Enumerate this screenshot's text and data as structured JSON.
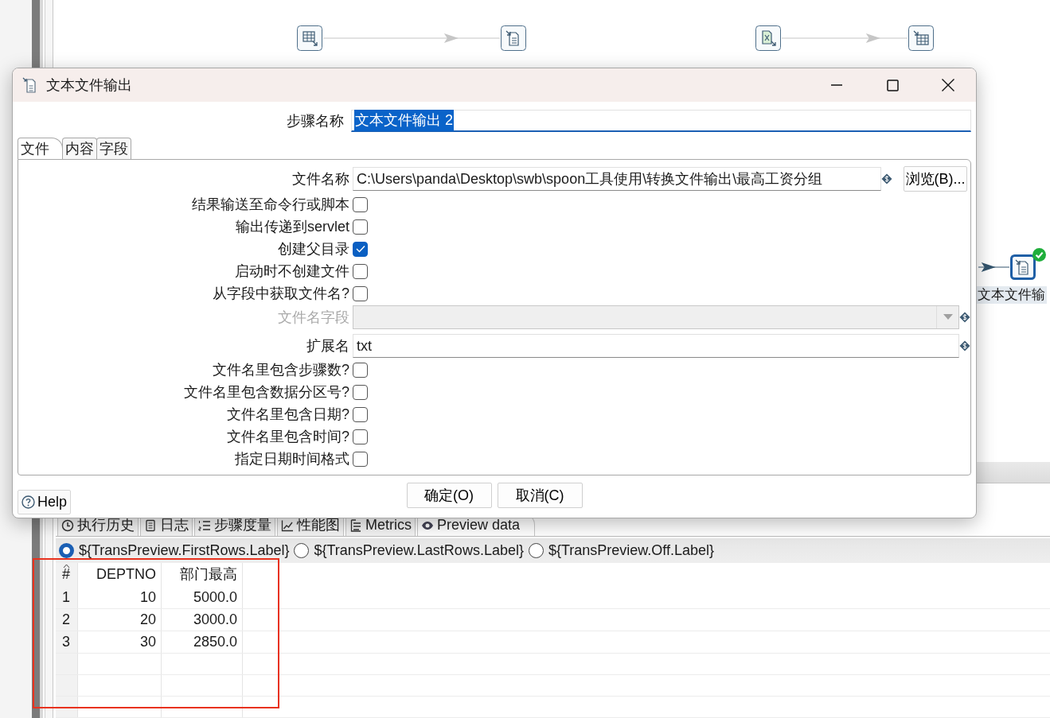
{
  "canvas": {
    "nodes": [
      {
        "kind": "table_input",
        "selected": false,
        "outgoing_hop": true
      },
      {
        "kind": "text_output",
        "selected": false
      },
      {
        "kind": "excel_input",
        "selected": false,
        "outgoing_hop": true
      },
      {
        "kind": "table_output",
        "selected": false
      },
      {
        "kind": "text_output",
        "label": "文本文件输",
        "selected": true,
        "finished": true,
        "incoming_hop": true
      }
    ]
  },
  "results": {
    "tabs": [
      {
        "kind": "history",
        "label": "执行历史",
        "selected": false
      },
      {
        "kind": "log",
        "label": "日志",
        "selected": false
      },
      {
        "kind": "step_metrics",
        "label": "步骤度量",
        "selected": false
      },
      {
        "kind": "performance",
        "label": "性能图",
        "selected": false
      },
      {
        "kind": "metrics",
        "label": "Metrics",
        "selected": false
      },
      {
        "kind": "preview",
        "label": "Preview data",
        "selected": true
      }
    ],
    "preview_modes": [
      {
        "label": "${TransPreview.FirstRows.Label}",
        "selected": true
      },
      {
        "label": "${TransPreview.LastRows.Label}",
        "selected": false
      },
      {
        "label": "${TransPreview.Off.Label}",
        "selected": false
      }
    ],
    "table": {
      "columns": [
        "#",
        "DEPTNO",
        "部门最高"
      ],
      "rows": [
        [
          "1",
          "10",
          "5000.0"
        ],
        [
          "2",
          "20",
          "3000.0"
        ],
        [
          "3",
          "30",
          "2850.0"
        ]
      ]
    }
  },
  "dialog": {
    "title": "文本文件输出",
    "step_name": {
      "label": "步骤名称",
      "value": "文本文件输出 2",
      "highlighted": true
    },
    "tabs": [
      {
        "label": "文件",
        "selected": true
      },
      {
        "label": "内容",
        "selected": false
      },
      {
        "label": "字段",
        "selected": false
      }
    ],
    "fields": [
      {
        "kind": "text",
        "label": "文件名称",
        "value": "C:\\Users\\panda\\Desktop\\swb\\spoon工具使用\\转换文件输出\\最高工资分组",
        "variable": true,
        "button": "浏览(B)..."
      },
      {
        "kind": "checkbox",
        "label": "结果输送至命令行或脚本",
        "checked": false
      },
      {
        "kind": "checkbox",
        "label": "输出传递到servlet",
        "checked": false
      },
      {
        "kind": "checkbox",
        "label": "创建父目录",
        "checked": true
      },
      {
        "kind": "checkbox",
        "label": "启动时不创建文件",
        "checked": false
      },
      {
        "kind": "checkbox",
        "label": "从字段中获取文件名?",
        "checked": false
      },
      {
        "kind": "combo",
        "label": "文件名字段",
        "disabled": true,
        "variable": true
      },
      {
        "kind": "text",
        "label": "扩展名",
        "value": "txt",
        "variable": true
      },
      {
        "kind": "checkbox",
        "label": "文件名里包含步骤数?",
        "checked": false
      },
      {
        "kind": "checkbox",
        "label": "文件名里包含数据分区号?",
        "checked": false
      },
      {
        "kind": "checkbox",
        "label": "文件名里包含日期?",
        "checked": false
      },
      {
        "kind": "checkbox",
        "label": "文件名里包含时间?",
        "checked": false
      },
      {
        "kind": "checkbox",
        "label": "指定日期时间格式",
        "checked": false
      }
    ],
    "help": "Help",
    "buttons": [
      {
        "label": "确定(O)"
      },
      {
        "label": "取消(C)"
      }
    ]
  },
  "annotation": {
    "kind": "rectangle"
  }
}
